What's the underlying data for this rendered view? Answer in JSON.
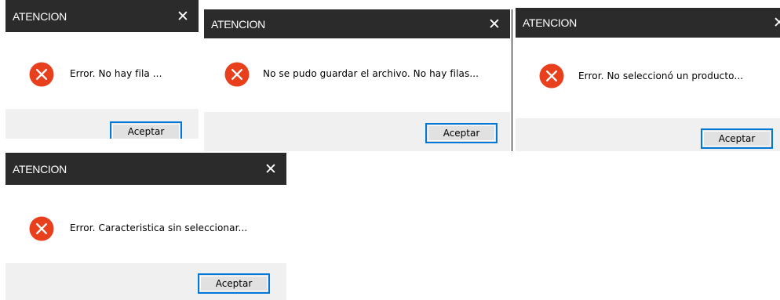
{
  "dialogs": [
    {
      "title": "ATENCION",
      "close": "✕",
      "icon": "error-icon",
      "message": "Error. No hay fila ...",
      "button": "Aceptar"
    },
    {
      "title": "ATENCION",
      "close": "✕",
      "icon": "error-icon",
      "message": "No se pudo guardar el archivo. No hay filas...",
      "button": "Aceptar"
    },
    {
      "title": "ATENCION",
      "close": "✕",
      "icon": "error-icon",
      "message": "Error. No seleccionó un producto...",
      "button": "Aceptar"
    },
    {
      "title": "ATENCION",
      "close": "✕",
      "icon": "error-icon",
      "message": "Error. Caracteristica sin seleccionar...",
      "button": "Aceptar"
    }
  ],
  "colors": {
    "titlebar": "#2b2b2b",
    "footer": "#f0f0f0",
    "error_red": "#e8401c",
    "button_border": "#0078d7"
  }
}
